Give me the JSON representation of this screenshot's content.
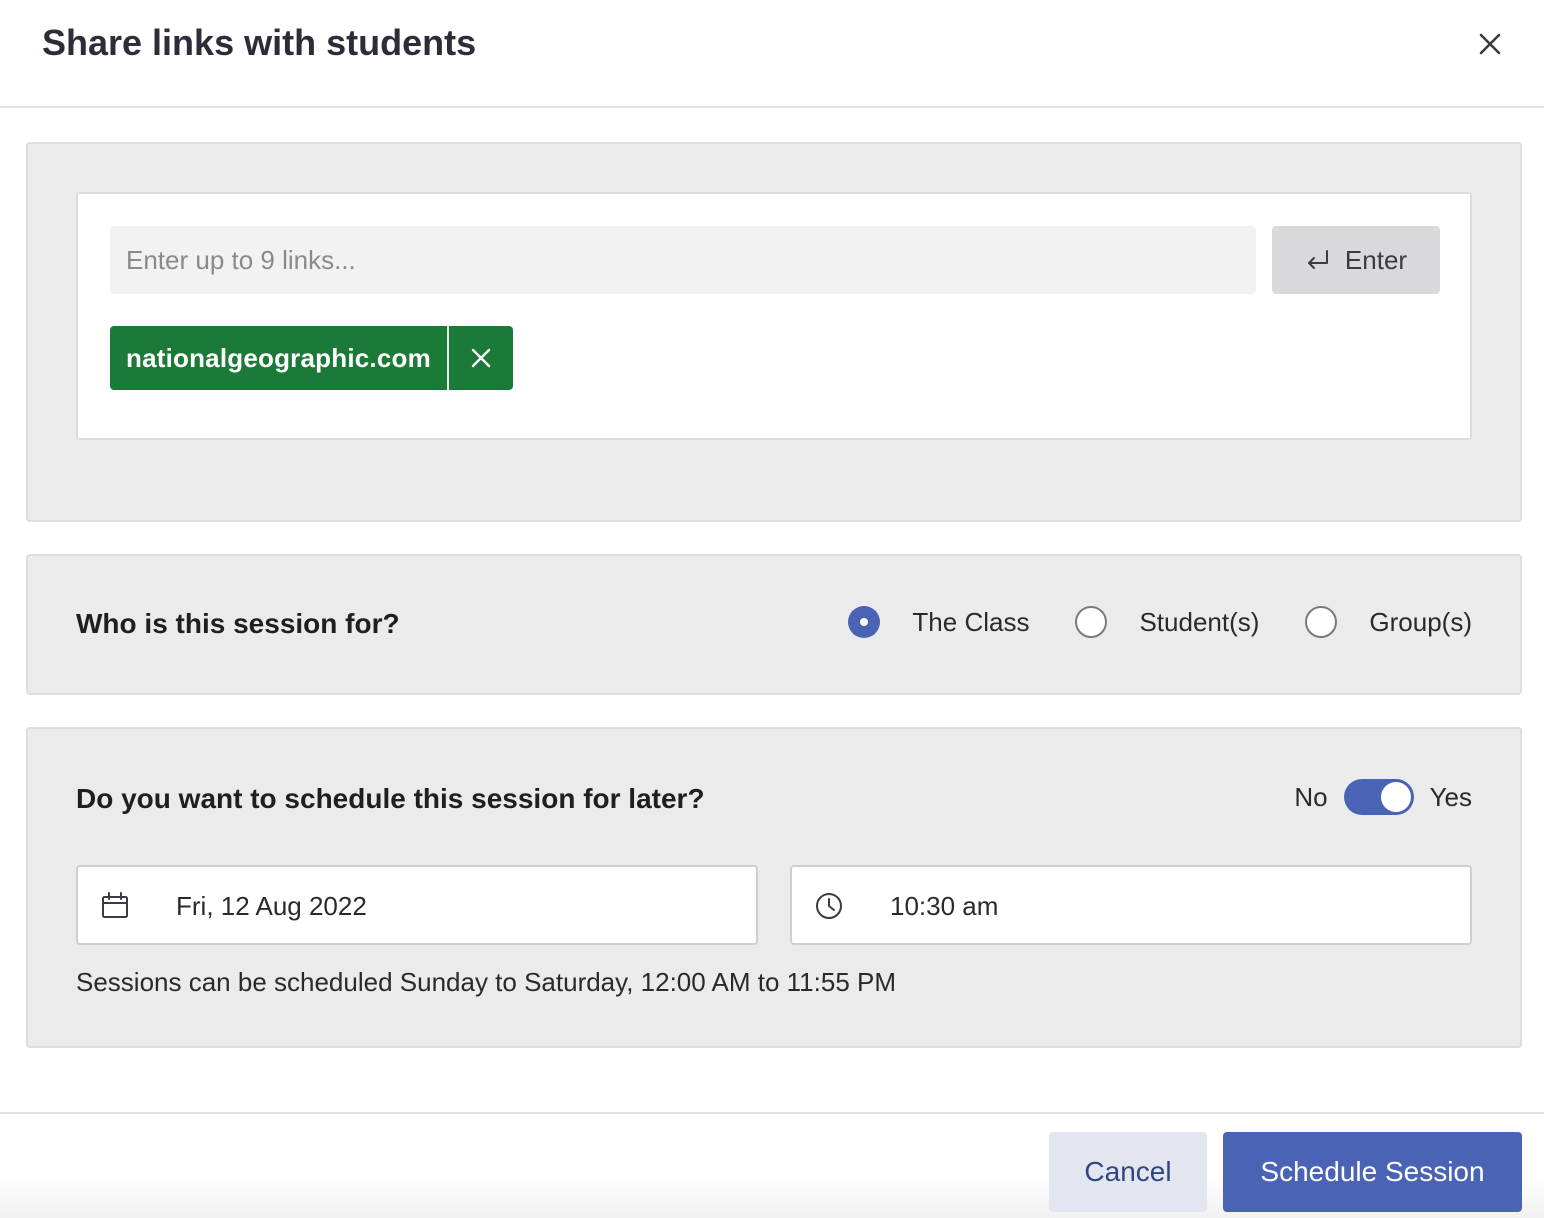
{
  "dialog": {
    "title": "Share links with students"
  },
  "links": {
    "placeholder": "Enter up to 9 links...",
    "value": "",
    "enter_label": "Enter",
    "chips": [
      {
        "label": "nationalgeographic.com"
      }
    ]
  },
  "audience": {
    "question": "Who is this session for?",
    "options": [
      {
        "label": "The Class",
        "selected": true
      },
      {
        "label": "Student(s)",
        "selected": false
      },
      {
        "label": "Group(s)",
        "selected": false
      }
    ]
  },
  "schedule": {
    "question": "Do you want to schedule this session for later?",
    "toggle_off_label": "No",
    "toggle_on_label": "Yes",
    "toggle_on": true,
    "date": "Fri, 12 Aug 2022",
    "time": "10:30 am",
    "hint": "Sessions can be scheduled Sunday to Saturday, 12:00 AM to 11:55 PM"
  },
  "footer": {
    "cancel_label": "Cancel",
    "submit_label": "Schedule Session"
  },
  "colors": {
    "accent": "#4a63b5",
    "chip": "#1b7a37",
    "panel_bg": "#ebebeb"
  },
  "icons": {
    "close": "close-icon",
    "enter": "return-arrow-icon",
    "chip_remove": "close-icon",
    "date": "calendar-icon",
    "time": "clock-icon"
  }
}
